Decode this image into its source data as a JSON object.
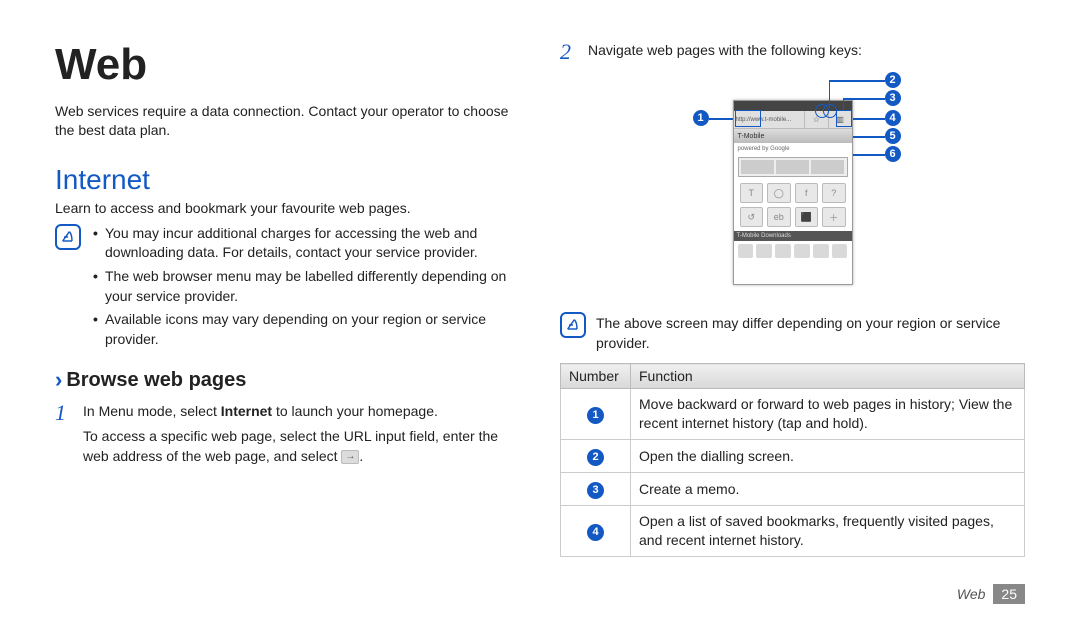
{
  "left": {
    "title": "Web",
    "intro": "Web services require a data connection. Contact your operator to choose the best data plan.",
    "section_heading": "Internet",
    "section_desc": "Learn to access and bookmark your favourite web pages.",
    "note_bullets": [
      "You may incur additional charges for accessing the web and downloading data. For details, contact your service provider.",
      "The web browser menu may be labelled differently depending on your service provider.",
      "Available icons may vary depending on your region or service provider."
    ],
    "subhead": "Browse web pages",
    "step1_a": "In Menu mode, select ",
    "step1_bold": "Internet",
    "step1_b": " to launch your homepage.",
    "step1_para2_a": "To access a specific web page, select the URL input field, enter the web address of the web page, and select ",
    "step1_para2_b": "."
  },
  "right": {
    "step2": "Navigate web pages with the following keys:",
    "note": "The above screen may differ depending on your region or service provider.",
    "table": {
      "head_num": "Number",
      "head_func": "Function",
      "rows": [
        {
          "n": "1",
          "f": "Move backward or forward to web pages in history; View the recent internet history (tap and hold)."
        },
        {
          "n": "2",
          "f": "Open the dialling screen."
        },
        {
          "n": "3",
          "f": "Create a memo."
        },
        {
          "n": "4",
          "f": "Open a list of saved bookmarks, frequently visited pages, and recent internet history."
        }
      ]
    },
    "phone_title": "T-Mobile",
    "phone_powered": "powered by Google",
    "phone_catbar": "T-Mobile Downloads"
  },
  "callouts": [
    "1",
    "2",
    "3",
    "4",
    "5",
    "6"
  ],
  "footer": {
    "section": "Web",
    "page": "25"
  }
}
